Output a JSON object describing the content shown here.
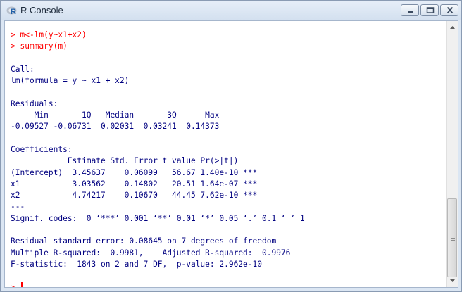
{
  "window": {
    "title": "R Console"
  },
  "console": {
    "lines": [
      {
        "text": "> m<-lm(y~x1+x2)",
        "color": "#ff0000"
      },
      {
        "text": "> summary(m)",
        "color": "#ff0000"
      },
      {
        "text": "",
        "color": "#000080"
      },
      {
        "text": "Call:",
        "color": "#000080"
      },
      {
        "text": "lm(formula = y ~ x1 + x2)",
        "color": "#000080"
      },
      {
        "text": "",
        "color": "#000080"
      },
      {
        "text": "Residuals:",
        "color": "#000080"
      },
      {
        "text": "     Min       1Q   Median       3Q      Max ",
        "color": "#000080"
      },
      {
        "text": "-0.09527 -0.06731  0.02031  0.03241  0.14373 ",
        "color": "#000080"
      },
      {
        "text": "",
        "color": "#000080"
      },
      {
        "text": "Coefficients:",
        "color": "#000080"
      },
      {
        "text": "            Estimate Std. Error t value Pr(>|t|)    ",
        "color": "#000080"
      },
      {
        "text": "(Intercept)  3.45637    0.06099   56.67 1.40e-10 ***",
        "color": "#000080"
      },
      {
        "text": "x1           3.03562    0.14802   20.51 1.64e-07 ***",
        "color": "#000080"
      },
      {
        "text": "x2           4.74217    0.10670   44.45 7.62e-10 ***",
        "color": "#000080"
      },
      {
        "text": "---",
        "color": "#000080"
      },
      {
        "text": "Signif. codes:  0 ‘***’ 0.001 ‘**’ 0.01 ‘*’ 0.05 ‘.’ 0.1 ‘ ’ 1 ",
        "color": "#000080"
      },
      {
        "text": "",
        "color": "#000080"
      },
      {
        "text": "Residual standard error: 0.08645 on 7 degrees of freedom",
        "color": "#000080"
      },
      {
        "text": "Multiple R-squared:  0.9981,\tAdjusted R-squared:  0.9976 ",
        "color": "#000080"
      },
      {
        "text": "F-statistic:  1843 on 2 and 7 DF,  p-value: 2.962e-10",
        "color": "#000080"
      },
      {
        "text": "",
        "color": "#000080"
      }
    ],
    "prompt": ">",
    "input_value": ""
  },
  "icons": {
    "app": "r-logo-icon",
    "minimize": "minimize-icon",
    "maximize": "maximize-icon",
    "close": "close-icon"
  },
  "colors": {
    "input": "#ff0000",
    "output": "#000080"
  }
}
